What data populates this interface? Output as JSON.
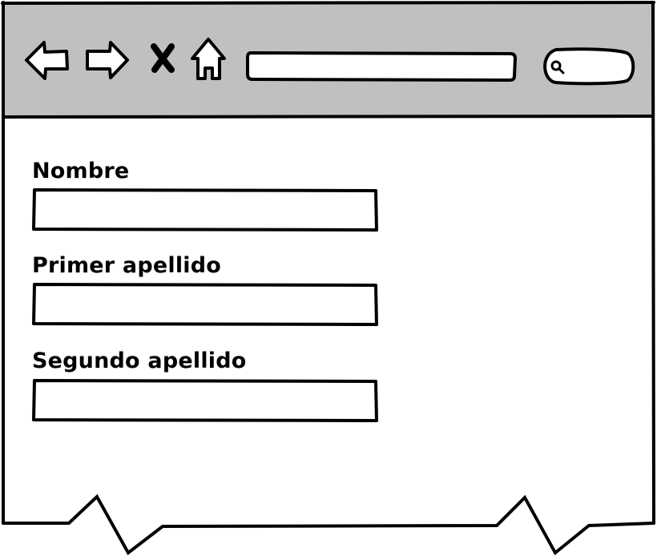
{
  "browser": {
    "toolbar_color": "#c0c0c0",
    "address_bar": {
      "value": "",
      "placeholder": ""
    },
    "search": {
      "value": "",
      "placeholder": ""
    },
    "buttons": {
      "back_icon": "arrow-left-icon",
      "forward_icon": "arrow-right-icon",
      "stop_icon": "close-icon",
      "home_icon": "home-icon",
      "search_icon": "magnifier-icon"
    }
  },
  "form": {
    "fields": [
      {
        "label": "Nombre",
        "value": "",
        "placeholder": ""
      },
      {
        "label": "Primer apellido",
        "value": "",
        "placeholder": ""
      },
      {
        "label": "Segundo apellido",
        "value": "",
        "placeholder": ""
      }
    ]
  }
}
